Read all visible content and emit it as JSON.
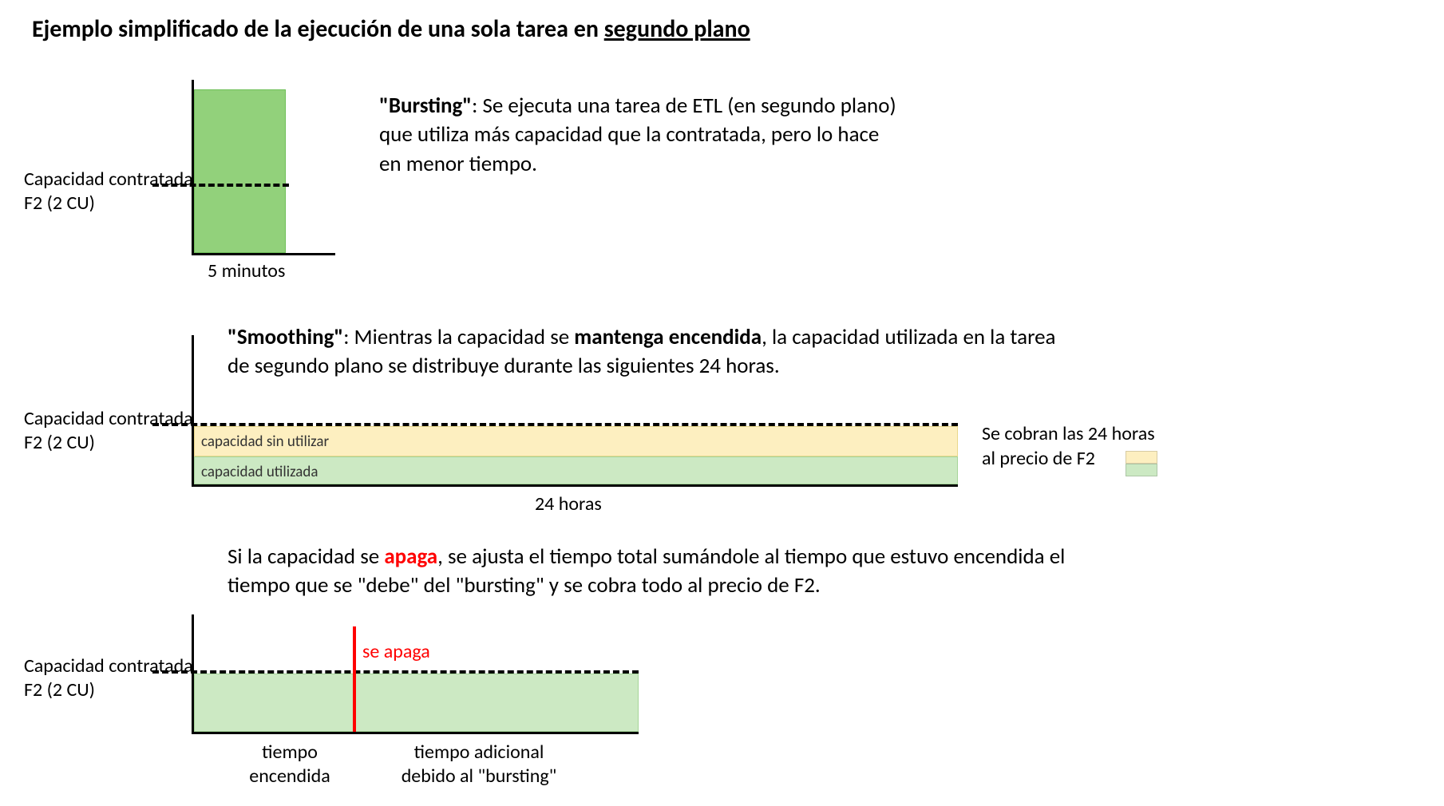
{
  "title_prefix": "Ejemplo simplificado de la ejecución de una sola tarea en ",
  "title_underline": "segundo plano",
  "ylabel_line1": "Capacidad contratada",
  "ylabel_line2": "F2 (2 CU)",
  "chart1": {
    "concept": "\"Bursting\"",
    "desc": ": Se ejecuta una tarea de ETL (en segundo plano) que utiliza más capacidad que la contratada, pero lo hace en menor tiempo.",
    "xlabel": "5 minutos"
  },
  "chart2": {
    "concept": "\"Smoothing\"",
    "desc_pre": ": Mientras  la capacidad se ",
    "desc_bold": "mantenga encendida",
    "desc_post": ", la capacidad utilizada en la tarea de segundo plano se distribuye durante las siguientes 24 horas.",
    "unused_label": "capacidad sin utilizar",
    "used_label": "capacidad utilizada",
    "xlabel": "24 horas",
    "note_line1": "Se cobran las 24 horas",
    "note_line2": "al precio de F2"
  },
  "chart3": {
    "desc_pre": "Si la capacidad se ",
    "desc_red": "apaga",
    "desc_post": ", se ajusta el tiempo total sumándole al tiempo que estuvo encendida el tiempo que se \"debe\" del \"bursting\" y se cobra todo al precio de F2.",
    "red_label": "se apaga",
    "xlabel_left_line1": "tiempo",
    "xlabel_left_line2": "encendida",
    "xlabel_right_line1": "tiempo adicional",
    "xlabel_right_line2": "debido al \"bursting\""
  },
  "chart_data": [
    {
      "type": "bar",
      "title": "Bursting",
      "xlabel": "5 minutos",
      "ylabel": "Capacidad",
      "capacity_threshold_CU": 2,
      "series": [
        {
          "name": "tarea ETL (bursting)",
          "value_CU": 5,
          "duration": "5 minutos"
        }
      ]
    },
    {
      "type": "area",
      "title": "Smoothing (24 horas)",
      "xlabel": "24 horas",
      "ylabel": "Capacidad",
      "capacity_threshold_CU": 2,
      "series": [
        {
          "name": "capacidad utilizada",
          "value_CU": 1
        },
        {
          "name": "capacidad sin utilizar",
          "value_CU": 1
        }
      ],
      "note": "Se cobran las 24 horas al precio de F2"
    },
    {
      "type": "area",
      "title": "Apagado durante smoothing",
      "ylabel": "Capacidad",
      "capacity_threshold_CU": 2,
      "event": {
        "name": "se apaga",
        "position_fraction": 0.36
      },
      "segments": [
        {
          "name": "tiempo encendida",
          "fraction": 0.36
        },
        {
          "name": "tiempo adicional debido al bursting",
          "fraction": 0.64
        }
      ]
    }
  ]
}
